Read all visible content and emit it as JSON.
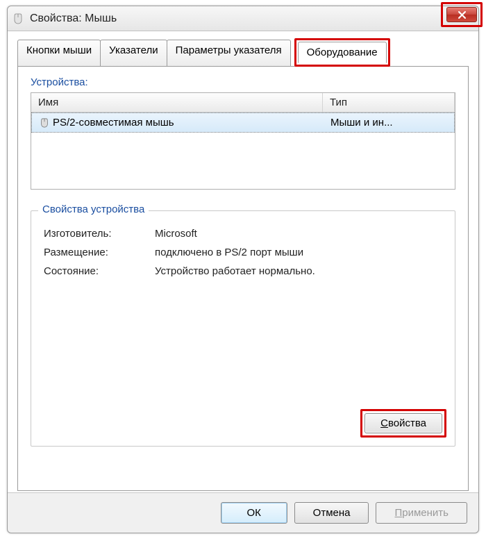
{
  "titlebar": {
    "title": "Свойства: Мышь"
  },
  "tabs": {
    "buttons": "Кнопки мыши",
    "pointers": "Указатели",
    "pointer_opts": "Параметры указателя",
    "hardware": "Оборудование"
  },
  "devices": {
    "label": "Устройства:",
    "columns": {
      "name": "Имя",
      "type": "Тип"
    },
    "rows": [
      {
        "name": "PS/2-совместимая мышь",
        "type": "Мыши и ин..."
      }
    ]
  },
  "props": {
    "group_title": "Свойства устройства",
    "manufacturer_label": "Изготовитель:",
    "manufacturer_value": "Microsoft",
    "location_label": "Размещение:",
    "location_value": "подключено в PS/2 порт мыши",
    "status_label": "Состояние:",
    "status_value": "Устройство работает нормально.",
    "properties_btn": "Свойства"
  },
  "footer": {
    "ok": "ОК",
    "cancel": "Отмена",
    "apply": "Применить"
  },
  "accel": {
    "properties_u": "С",
    "properties_rest": "войства",
    "apply_u": "П",
    "apply_rest": "рименить"
  }
}
